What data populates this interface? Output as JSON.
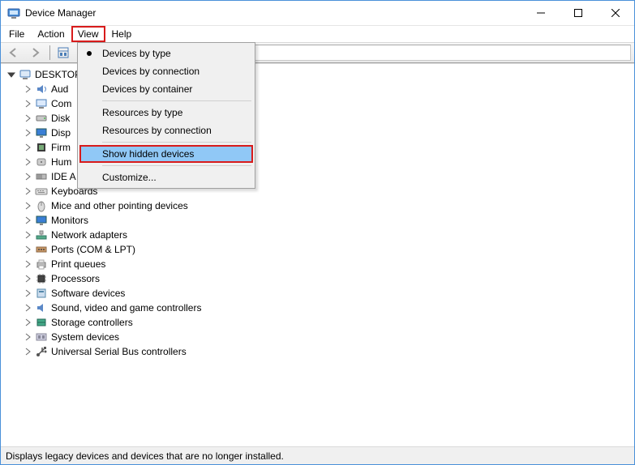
{
  "window": {
    "title": "Device Manager",
    "root_node": "DESKTOP"
  },
  "menubar": {
    "items": [
      "File",
      "Action",
      "View",
      "Help"
    ],
    "highlighted_index": 2
  },
  "dropdown": {
    "groups": [
      {
        "items": [
          "Devices by type",
          "Devices by connection",
          "Devices by container"
        ],
        "selected_index": 0
      },
      {
        "items": [
          "Resources by type",
          "Resources by connection"
        ],
        "selected_index": null
      },
      {
        "items": [
          "Show hidden devices"
        ],
        "selected_index": null,
        "highlighted_index": 0,
        "red_box": true
      },
      {
        "items": [
          "Customize..."
        ],
        "selected_index": null
      }
    ]
  },
  "tree": {
    "items": [
      {
        "label": "Audio inputs and outputs",
        "truncated": "Aud",
        "icon": "audio"
      },
      {
        "label": "Computer",
        "truncated": "Com",
        "icon": "computer"
      },
      {
        "label": "Disk drives",
        "truncated": "Disk",
        "icon": "disk"
      },
      {
        "label": "Display adapters",
        "truncated": "Disp",
        "icon": "display"
      },
      {
        "label": "Firmware",
        "truncated": "Firm",
        "icon": "firmware"
      },
      {
        "label": "Human Interface Devices",
        "truncated": "Hum",
        "icon": "hid"
      },
      {
        "label": "IDE ATA/ATAPI controllers",
        "truncated": "IDE A",
        "icon": "ide"
      },
      {
        "label": "Keyboards",
        "icon": "keyboard"
      },
      {
        "label": "Mice and other pointing devices",
        "icon": "mouse"
      },
      {
        "label": "Monitors",
        "icon": "monitor"
      },
      {
        "label": "Network adapters",
        "icon": "network"
      },
      {
        "label": "Ports (COM & LPT)",
        "icon": "port"
      },
      {
        "label": "Print queues",
        "icon": "printer"
      },
      {
        "label": "Processors",
        "icon": "cpu"
      },
      {
        "label": "Software devices",
        "icon": "software"
      },
      {
        "label": "Sound, video and game controllers",
        "icon": "sound"
      },
      {
        "label": "Storage controllers",
        "icon": "storage"
      },
      {
        "label": "System devices",
        "icon": "system"
      },
      {
        "label": "Universal Serial Bus controllers",
        "icon": "usb"
      }
    ]
  },
  "statusbar": {
    "text": "Displays legacy devices and devices that are no longer installed."
  }
}
